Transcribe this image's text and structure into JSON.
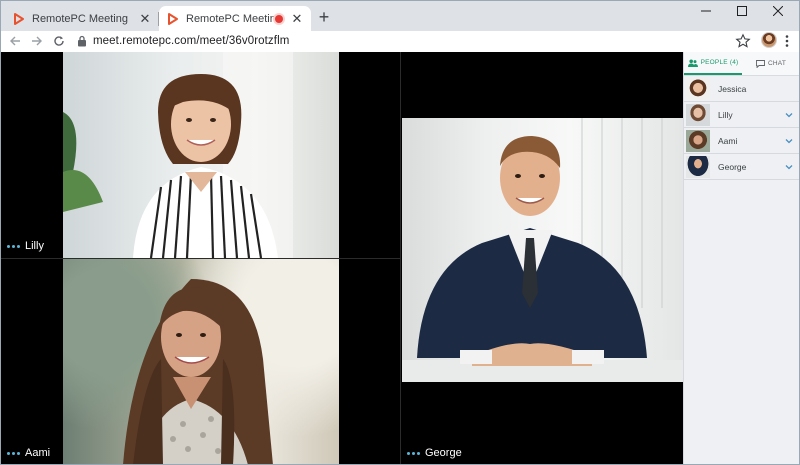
{
  "browser": {
    "tabs": [
      {
        "title": "RemotePC Meeting",
        "active": false
      },
      {
        "title": "RemotePC Meeting",
        "active": true,
        "recording": true
      }
    ],
    "new_tab_symbol": "+",
    "url": "meet.remotepc.com/meet/36v0rotzflm",
    "icons": [
      "back-icon",
      "forward-icon",
      "reload-icon",
      "lock-icon",
      "star-icon",
      "profile-avatar",
      "menu-icon"
    ],
    "window_controls": [
      "minimize",
      "maximize",
      "close"
    ]
  },
  "meeting": {
    "participants_tiles": [
      {
        "name": "Lilly"
      },
      {
        "name": "Aami"
      },
      {
        "name": "George"
      }
    ]
  },
  "sidebar": {
    "tabs": {
      "people": "PEOPLE (4)",
      "chat": "CHAT"
    },
    "people": [
      {
        "name": "Jessica",
        "expandable": false
      },
      {
        "name": "Lilly",
        "expandable": true
      },
      {
        "name": "Aami",
        "expandable": true
      },
      {
        "name": "George",
        "expandable": true
      }
    ]
  },
  "colors": {
    "accent": "#1a9a6c",
    "recording": "#e53935",
    "speaking_dots": "#5bb5d6",
    "chevron": "#4a90c2"
  }
}
